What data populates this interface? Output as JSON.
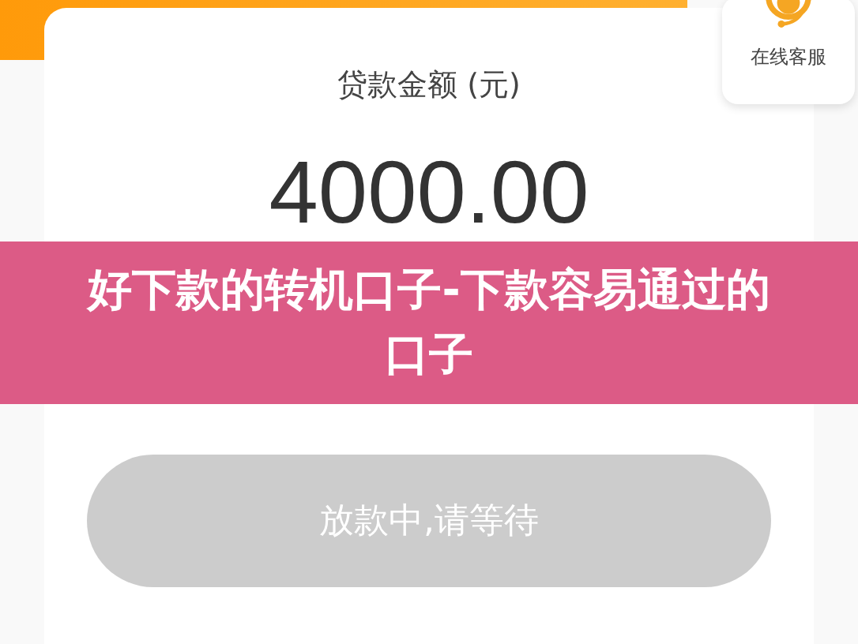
{
  "loan_card": {
    "label": "贷款金额 (元)",
    "amount": "4000.00"
  },
  "support_button": {
    "label": "在线客服"
  },
  "submit_button": {
    "label": "放款中,请等待",
    "disabled": true
  },
  "banner": {
    "title": "好下款的转机口子-下款容易通过的口子"
  }
}
